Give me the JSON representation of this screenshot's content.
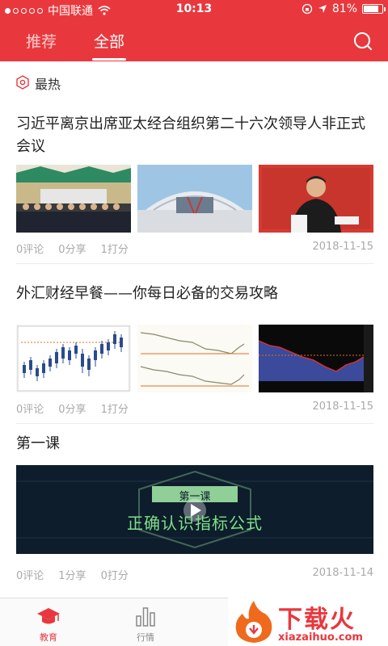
{
  "status_bar": {
    "carrier": "中国联通",
    "time": "10:13",
    "battery": "81%",
    "battery_level": 0.81
  },
  "nav": {
    "tabs": [
      {
        "label": "推荐",
        "active": false
      },
      {
        "label": "全部",
        "active": true
      }
    ],
    "search_icon": "search-icon"
  },
  "section": {
    "title": "最热",
    "icon": "hexagon-icon"
  },
  "articles": [
    {
      "title": "习近平离京出席亚太经合组织第二十六次领导人非正式会议",
      "images": [
        "group-photo",
        "conference-building",
        "speaker-portrait"
      ],
      "comments": "0评论",
      "shares": "0分享",
      "scores": "1打分",
      "date": "2018-11-15"
    },
    {
      "title": "外汇财经早餐——你每日必备的交易攻略",
      "images": [
        "candlestick-chart",
        "line-chart",
        "dark-chart"
      ],
      "comments": "0评论",
      "shares": "0分享",
      "scores": "1打分",
      "date": "2018-11-15"
    },
    {
      "title": "第一课",
      "banner": {
        "badge": "第一课",
        "headline": "正确认识指标公式"
      },
      "comments": "0评论",
      "shares": "1分享",
      "scores": "0打分",
      "date": "2018-11-14"
    }
  ],
  "tab_bar": {
    "items": [
      {
        "label": "教育",
        "icon": "graduation-cap-icon",
        "active": true
      },
      {
        "label": "行情",
        "icon": "bar-chart-icon",
        "active": false
      }
    ]
  },
  "watermark": {
    "text": "下载火",
    "url": "xiazaihuo.com"
  },
  "colors": {
    "brand": "#e8383d",
    "meta_text": "#aaaaaa"
  }
}
